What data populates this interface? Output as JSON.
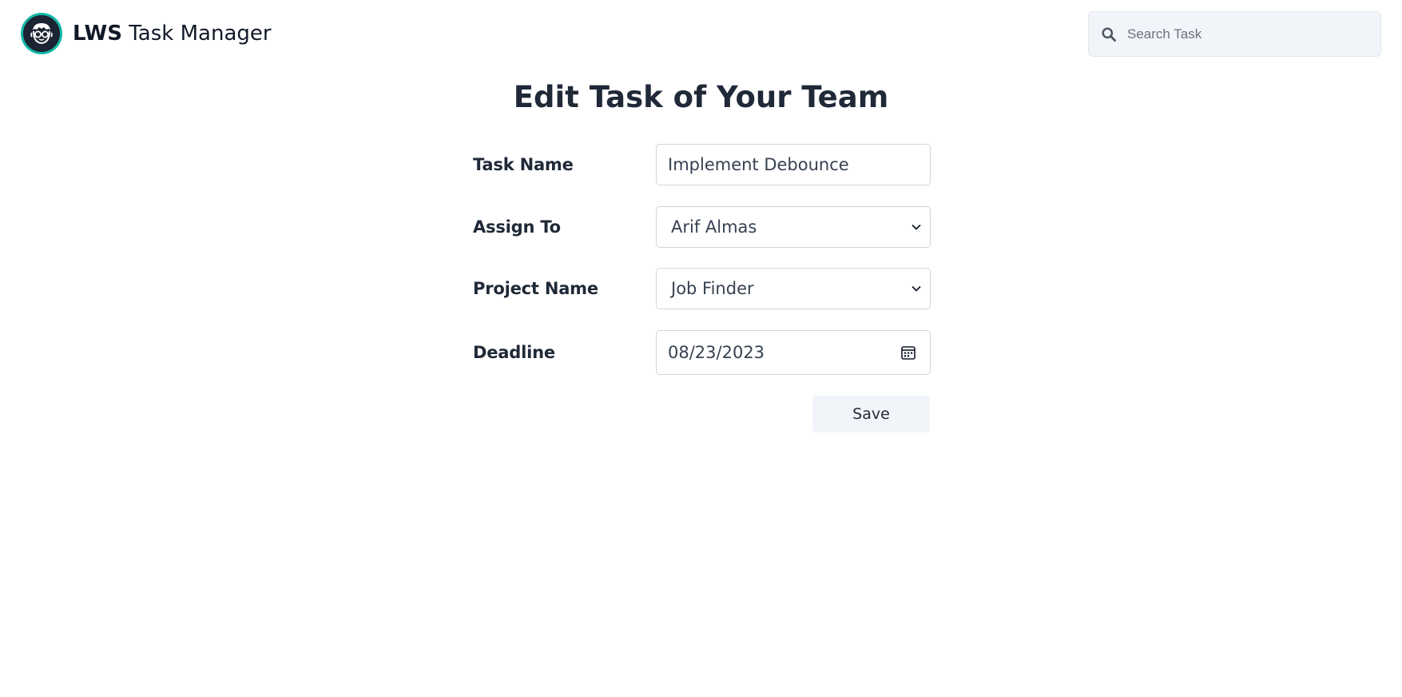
{
  "header": {
    "brand_strong": "LWS",
    "brand_rest": " Task Manager",
    "search_placeholder": "Search Task"
  },
  "page": {
    "title": "Edit Task of Your Team"
  },
  "form": {
    "task_name": {
      "label": "Task Name",
      "value": "Implement Debounce"
    },
    "assign_to": {
      "label": "Assign To",
      "value": "Arif Almas"
    },
    "project_name": {
      "label": "Project Name",
      "value": "Job Finder"
    },
    "deadline": {
      "label": "Deadline",
      "value": "08/23/2023"
    },
    "save_label": "Save"
  },
  "colors": {
    "accent_ring": "#14b8a6",
    "logo_bg": "#1c2333",
    "input_bg": "#f1f4f8",
    "text_dark": "#1f2937"
  },
  "icons": {
    "logo": "developer-avatar-icon",
    "search": "search-icon",
    "select_arrow": "chevron-down-icon",
    "date": "calendar-icon"
  }
}
